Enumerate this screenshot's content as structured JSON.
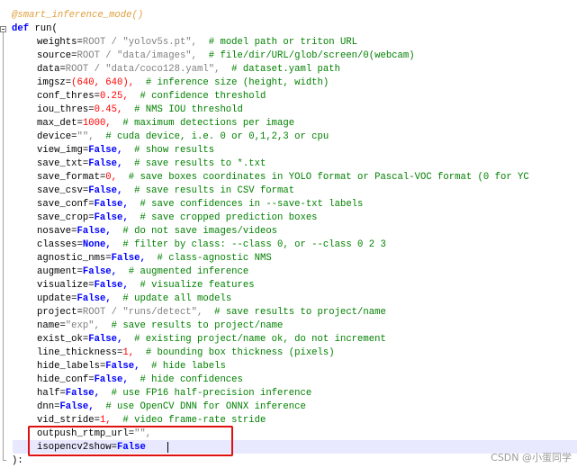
{
  "decorator": "@smart_inference_mode()",
  "def_line": {
    "keyword": "def",
    "name": "run("
  },
  "params": [
    {
      "name": "weights",
      "value": "ROOT / \"yolov5s.pt\",",
      "vtype": "str",
      "comment": "# model path or triton URL"
    },
    {
      "name": "source",
      "value": "ROOT / \"data/images\",",
      "vtype": "str",
      "comment": "# file/dir/URL/glob/screen/0(webcam)"
    },
    {
      "name": "data",
      "value": "ROOT / \"data/coco128.yaml\",",
      "vtype": "str",
      "comment": "# dataset.yaml path"
    },
    {
      "name": "imgsz",
      "value": "(640, 640),",
      "vtype": "num",
      "comment": "# inference size (height, width)"
    },
    {
      "name": "conf_thres",
      "value": "0.25,",
      "vtype": "num",
      "comment": "# confidence threshold"
    },
    {
      "name": "iou_thres",
      "value": "0.45,",
      "vtype": "num",
      "comment": "# NMS IOU threshold"
    },
    {
      "name": "max_det",
      "value": "1000,",
      "vtype": "num",
      "comment": "# maximum detections per image"
    },
    {
      "name": "device",
      "value": "\"\",",
      "vtype": "str",
      "comment": "# cuda device, i.e. 0 or 0,1,2,3 or cpu"
    },
    {
      "name": "view_img",
      "value": "False,",
      "vtype": "kw",
      "comment": "# show results"
    },
    {
      "name": "save_txt",
      "value": "False,",
      "vtype": "kw",
      "comment": "# save results to *.txt"
    },
    {
      "name": "save_format",
      "value": "0,",
      "vtype": "num",
      "comment": "# save boxes coordinates in YOLO format or Pascal-VOC format (0 for YC"
    },
    {
      "name": "save_csv",
      "value": "False,",
      "vtype": "kw",
      "comment": "# save results in CSV format"
    },
    {
      "name": "save_conf",
      "value": "False,",
      "vtype": "kw",
      "comment": "# save confidences in --save-txt labels"
    },
    {
      "name": "save_crop",
      "value": "False,",
      "vtype": "kw",
      "comment": "# save cropped prediction boxes"
    },
    {
      "name": "nosave",
      "value": "False,",
      "vtype": "kw",
      "comment": "# do not save images/videos"
    },
    {
      "name": "classes",
      "value": "None,",
      "vtype": "kw",
      "comment": "# filter by class: --class 0, or --class 0 2 3"
    },
    {
      "name": "agnostic_nms",
      "value": "False,",
      "vtype": "kw",
      "comment": "# class-agnostic NMS"
    },
    {
      "name": "augment",
      "value": "False,",
      "vtype": "kw",
      "comment": "# augmented inference"
    },
    {
      "name": "visualize",
      "value": "False,",
      "vtype": "kw",
      "comment": "# visualize features"
    },
    {
      "name": "update",
      "value": "False,",
      "vtype": "kw",
      "comment": "# update all models"
    },
    {
      "name": "project",
      "value": "ROOT / \"runs/detect\",",
      "vtype": "str",
      "comment": "# save results to project/name"
    },
    {
      "name": "name",
      "value": "\"exp\",",
      "vtype": "str",
      "comment": "# save results to project/name"
    },
    {
      "name": "exist_ok",
      "value": "False,",
      "vtype": "kw",
      "comment": "# existing project/name ok, do not increment"
    },
    {
      "name": "line_thickness",
      "value": "1,",
      "vtype": "num",
      "comment": "# bounding box thickness (pixels)"
    },
    {
      "name": "hide_labels",
      "value": "False,",
      "vtype": "kw",
      "comment": "# hide labels"
    },
    {
      "name": "hide_conf",
      "value": "False,",
      "vtype": "kw",
      "comment": "# hide confidences"
    },
    {
      "name": "half",
      "value": "False,",
      "vtype": "kw",
      "comment": "# use FP16 half-precision inference"
    },
    {
      "name": "dnn",
      "value": "False,",
      "vtype": "kw",
      "comment": "# use OpenCV DNN for ONNX inference"
    },
    {
      "name": "vid_stride",
      "value": "1,",
      "vtype": "num",
      "comment": "# video frame-rate stride"
    },
    {
      "name": "outpush_rtmp_url",
      "value": "\"\",",
      "vtype": "str",
      "comment": ""
    },
    {
      "name": "isopencv2show",
      "value": "False",
      "vtype": "kw",
      "comment": ""
    }
  ],
  "closing": "):",
  "watermark": "CSDN @小蛋同学"
}
